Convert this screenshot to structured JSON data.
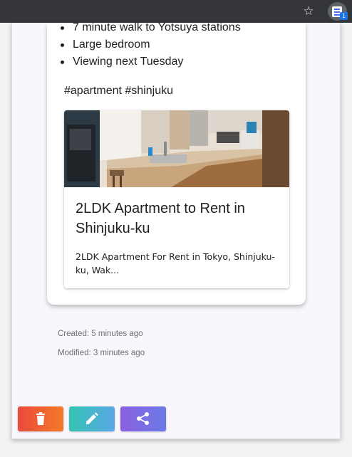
{
  "browser": {
    "bookmark_icon": "star-icon",
    "extension_icon": "document-icon",
    "extension_badge": "1",
    "toolbar_color": "#35363a"
  },
  "note": {
    "bullets": [
      "7 minute walk to Yotsuya stations",
      "Large bedroom",
      "Viewing next Tuesday"
    ],
    "tags": "#apartment #shinjuku",
    "link_preview": {
      "image_icon": "kitchen-photo",
      "title": "2LDK Apartment to Rent in Shinjuku-ku",
      "description": "2LDK Apartment For Rent in Tokyo, Shinjuku-ku, Wak..."
    },
    "created": "Created: 5 minutes ago",
    "modified": "Modified: 3 minutes ago"
  },
  "actions": [
    {
      "name": "delete",
      "icon": "trash-icon",
      "color": "#ea4a3c"
    },
    {
      "name": "edit",
      "icon": "pencil-icon",
      "color": "#35c3b3"
    },
    {
      "name": "share",
      "icon": "share-icon",
      "color": "#8a5fe0"
    }
  ]
}
